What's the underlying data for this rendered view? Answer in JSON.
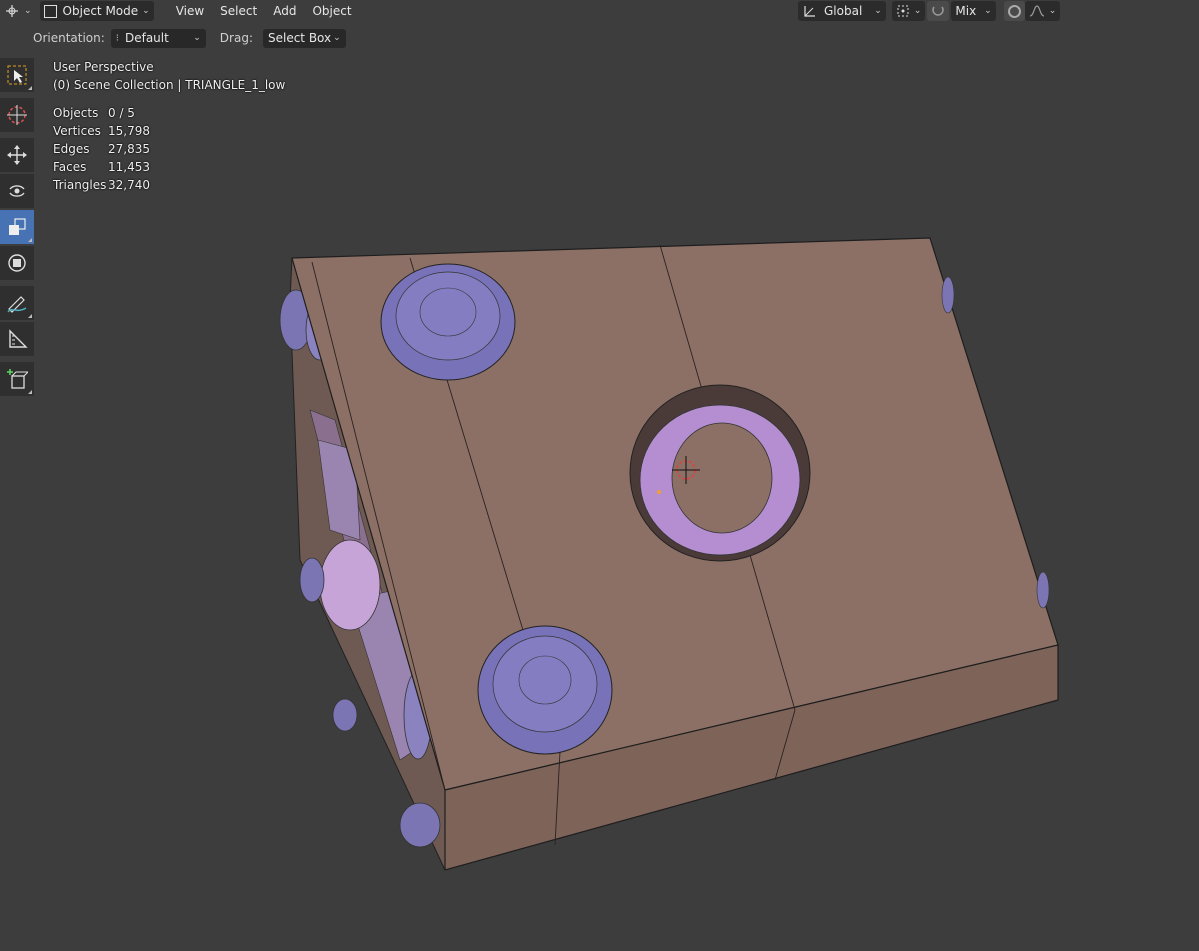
{
  "header": {
    "mode": "Object Mode",
    "menus": [
      "View",
      "Select",
      "Add",
      "Object"
    ],
    "transform_orientation": "Global",
    "overlay_shading": "Mix"
  },
  "tool_settings": {
    "orientation_label": "Orientation:",
    "orientation_value": "Default",
    "drag_label": "Drag:",
    "drag_value": "Select Box"
  },
  "viewport": {
    "view_name": "User Perspective",
    "collection": "(0) Scene Collection | TRIANGLE_1_low",
    "stats": [
      {
        "key": "Objects",
        "value": "0 / 5"
      },
      {
        "key": "Vertices",
        "value": "15,798"
      },
      {
        "key": "Edges",
        "value": "27,835"
      },
      {
        "key": "Faces",
        "value": "11,453"
      },
      {
        "key": "Triangles",
        "value": "32,740"
      }
    ]
  },
  "toolbar": {
    "tools": [
      {
        "name": "select-box-tool-icon",
        "active": false
      },
      {
        "name": "cursor-tool-icon",
        "active": false
      },
      {
        "name": "move-tool-icon",
        "active": false
      },
      {
        "name": "rotate-tool-icon",
        "active": false
      },
      {
        "name": "scale-tool-icon",
        "active": true
      },
      {
        "name": "transform-tool-icon",
        "active": false
      },
      {
        "name": "annotate-tool-icon",
        "active": false
      },
      {
        "name": "measure-tool-icon",
        "active": false
      },
      {
        "name": "add-cube-tool-icon",
        "active": false
      }
    ]
  },
  "colors": {
    "background": "#3d3d3d",
    "model_body": "#8c7065",
    "model_side": "#7a5f55",
    "model_accent": "#8078b8",
    "model_pink": "#b89ad0",
    "active_tool": "#4772b3"
  }
}
